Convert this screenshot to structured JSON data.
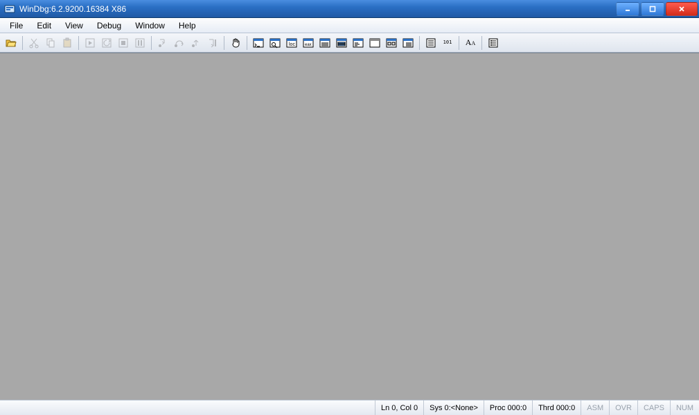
{
  "title": "WinDbg:6.2.9200.16384 X86",
  "menu": {
    "file": "File",
    "edit": "Edit",
    "view": "View",
    "debug": "Debug",
    "window": "Window",
    "help": "Help"
  },
  "toolbar_icons": {
    "open": "open-folder",
    "cut": "cut",
    "copy": "copy",
    "paste": "paste",
    "go": "go",
    "restart": "restart",
    "stop": "stop",
    "break": "break",
    "stepinto": "step-into",
    "stepover": "step-over",
    "stepout": "step-out",
    "runtocursor": "run-to-cursor",
    "hand": "hand",
    "cmd": "command-window",
    "watch": "watch-window",
    "locals": "locals-window",
    "registers": "registers-window",
    "memory": "memory-window",
    "callstack": "callstack-window",
    "disasm": "disassembly-window",
    "scratch": "scratchpad-window",
    "processes": "processes-window",
    "source": "source-window",
    "srcmode": "source-mode",
    "binary": "101",
    "font": "font",
    "options": "options"
  },
  "status": {
    "lncol": "Ln 0, Col 0",
    "sys": "Sys 0:<None>",
    "proc": "Proc 000:0",
    "thrd": "Thrd 000:0",
    "asm": "ASM",
    "ovr": "OVR",
    "caps": "CAPS",
    "num": "NUM"
  }
}
